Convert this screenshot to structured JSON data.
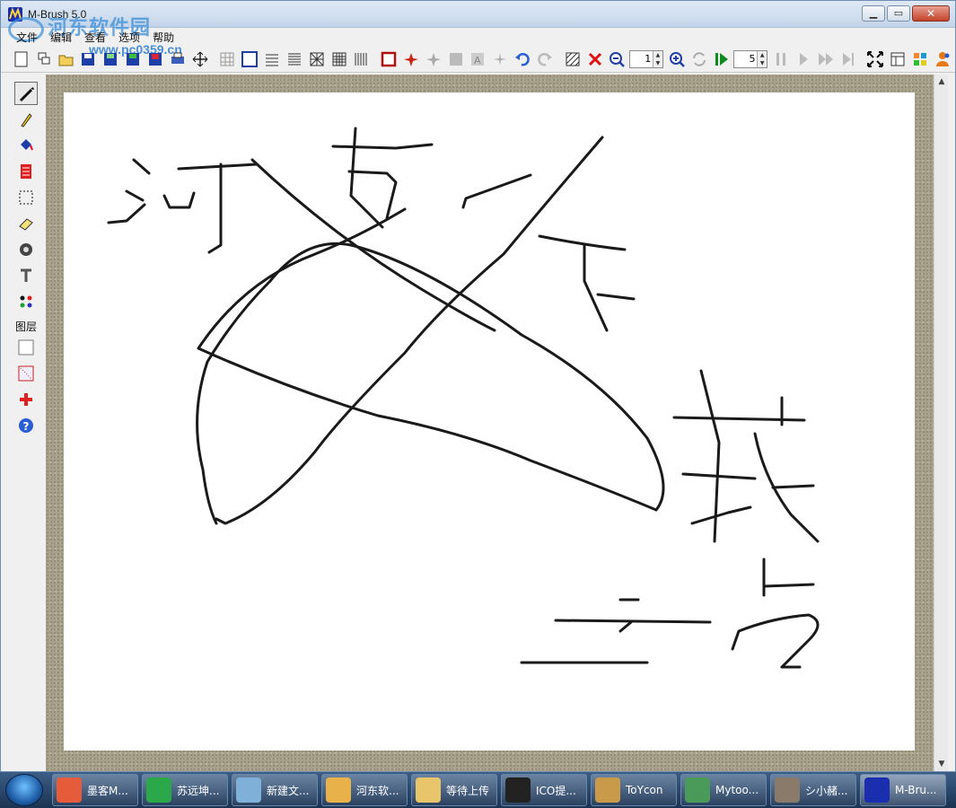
{
  "window": {
    "title": "M-Brush 5.0"
  },
  "watermark": {
    "text": "河东软件园",
    "url": "www.pc0359.cn"
  },
  "menu": [
    "文件",
    "编辑",
    "查看",
    "选项",
    "帮助"
  ],
  "toolbar": {
    "zoom_value": "1",
    "frame_value": "5"
  },
  "left_tools": {
    "layers_label": "图层"
  },
  "taskbar": {
    "items": [
      {
        "label": "墨客M...",
        "color": "#e65c3a"
      },
      {
        "label": "苏远坤...",
        "color": "#2ba84a"
      },
      {
        "label": "新建文...",
        "color": "#7fb0d8"
      },
      {
        "label": "河东软...",
        "color": "#e8b14a"
      },
      {
        "label": "等待上传",
        "color": "#e8c56a"
      },
      {
        "label": "ICO提...",
        "color": "#222222"
      },
      {
        "label": "ToYcon",
        "color": "#c99a4a"
      },
      {
        "label": "Mytoo...",
        "color": "#4a9a5a"
      },
      {
        "label": "シ小赭...",
        "color": "#8a7a6a"
      },
      {
        "label": "M-Bru...",
        "color": "#1a2fb0"
      }
    ]
  }
}
